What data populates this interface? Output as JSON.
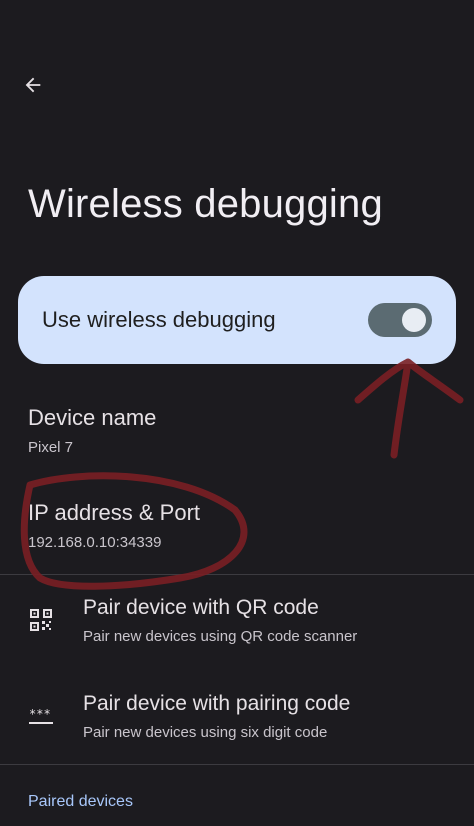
{
  "header": {
    "back_icon": "arrow-back-icon",
    "title": "Wireless debugging"
  },
  "toggle": {
    "label": "Use wireless debugging",
    "enabled": true
  },
  "device_name": {
    "title": "Device name",
    "value": "Pixel 7"
  },
  "ip_address": {
    "title": "IP address & Port",
    "value": "192.168.0.10:34339"
  },
  "actions": [
    {
      "icon": "qr-code-icon",
      "title": "Pair device with QR code",
      "subtitle": "Pair new devices using QR code scanner"
    },
    {
      "icon": "password-icon",
      "title": "Pair device with pairing code",
      "subtitle": "Pair new devices using six digit code"
    }
  ],
  "paired_devices": {
    "header": "Paired devices"
  },
  "colors": {
    "background": "#1c1b1f",
    "toggle_card": "#d3e3fd",
    "accent": "#a8c7fa",
    "annotation": "#7a1f24"
  }
}
